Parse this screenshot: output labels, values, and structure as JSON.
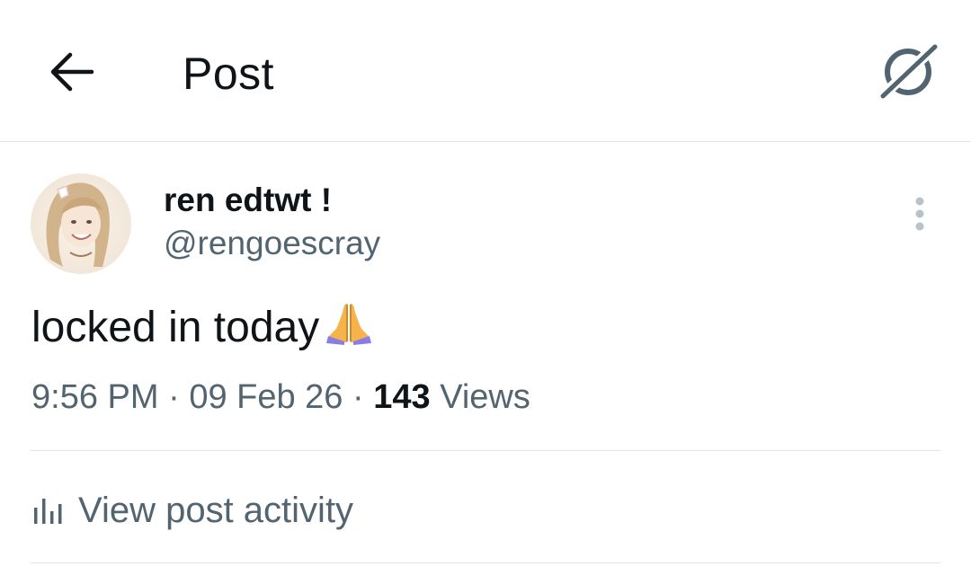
{
  "header": {
    "back_icon": "arrow-left-icon",
    "title": "Post",
    "grok_icon": "grok-icon"
  },
  "author": {
    "display_name": "ren edtwt !",
    "handle": "@rengoescray",
    "avatar_icon": "avatar"
  },
  "menu": {
    "more_icon": "more-vertical-icon"
  },
  "post": {
    "text": "locked in today",
    "emoji": "folded-hands-emoji"
  },
  "meta": {
    "time": "9:56 PM",
    "sep1": " · ",
    "date": "09 Feb 26",
    "sep2": " · ",
    "views_count": "143",
    "views_label": " Views"
  },
  "activity": {
    "icon": "analytics-bar-icon",
    "label": "View post activity"
  },
  "colors": {
    "text_primary": "#0f1419",
    "text_secondary": "#536471",
    "divider": "#e1e4e7"
  }
}
